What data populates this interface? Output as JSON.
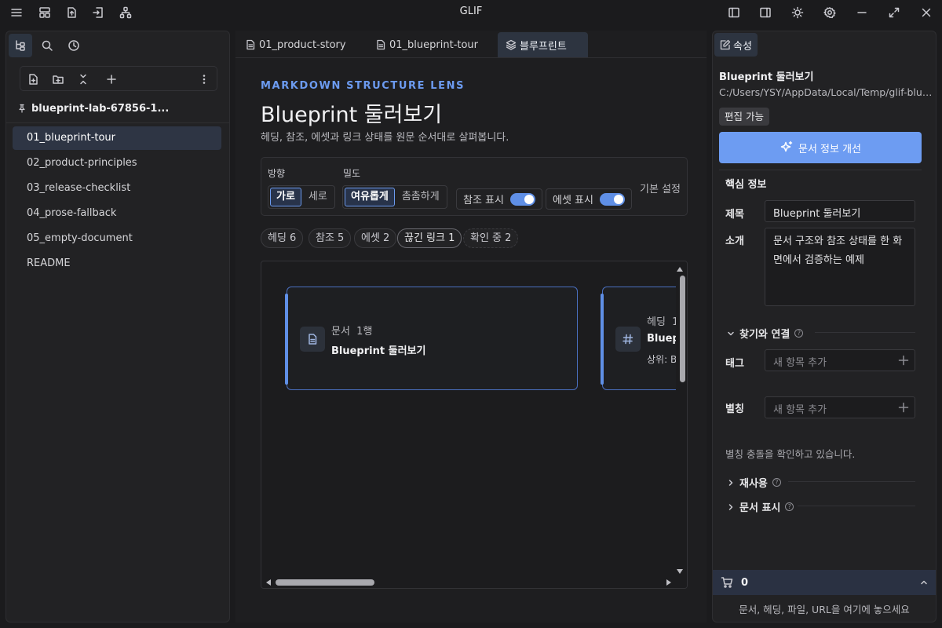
{
  "app": {
    "title": "GLIF"
  },
  "sidebar": {
    "vault_name": "blueprint-lab-67856-1...",
    "files": [
      {
        "label": "01_blueprint-tour",
        "active": true
      },
      {
        "label": "02_product-principles"
      },
      {
        "label": "03_release-checklist"
      },
      {
        "label": "04_prose-fallback"
      },
      {
        "label": "05_empty-document"
      },
      {
        "label": "README"
      }
    ]
  },
  "tabs": [
    {
      "label": "01_product-story"
    },
    {
      "label": "01_blueprint-tour"
    },
    {
      "label": "블루프린트",
      "active": true
    }
  ],
  "lens": {
    "eyebrow": "MARKDOWN STRUCTURE LENS",
    "title": "Blueprint 둘러보기",
    "subtitle": "헤딩, 참조, 에셋과 링크 상태를 원문 순서대로 살펴봅니다.",
    "orientation_label": "방향",
    "orientation_options": [
      "가로",
      "세로"
    ],
    "orientation_selected": "가로",
    "density_label": "밀도",
    "density_options": [
      "여유롭게",
      "촘촘하게"
    ],
    "density_selected": "여유롭게",
    "toggle_refs": "참조 표시",
    "toggle_assets": "에셋 표시",
    "reset_label": "기본 설정",
    "chips": [
      "헤딩 6",
      "참조 5",
      "에셋 2",
      "끊긴 링크 1",
      "확인 중 2"
    ],
    "nodes": [
      {
        "meta": "문서  1행",
        "title": "Blueprint 둘러보기"
      },
      {
        "meta": "헤딩  1",
        "title": "Bluep",
        "extra": "상위: B"
      }
    ]
  },
  "props": {
    "tab_label": "속성",
    "title": "Blueprint 둘러보기",
    "path": "C:/Users/YSY/AppData/Local/Temp/glif-blueprint-lab",
    "badge": "편집 가능",
    "improve_button": "문서 정보 개선",
    "core_section": "핵심 정보",
    "title_label": "제목",
    "title_value": "Blueprint 둘러보기",
    "intro_label": "소개",
    "intro_value": "문서 구조와 참조 상태를 한 화면에서 검증하는 예제",
    "find_section": "찾기와 연결",
    "tags_label": "태그",
    "tags_placeholder": "새 항목 추가",
    "alias_label": "별칭",
    "alias_placeholder": "새 항목 추가",
    "alias_note": "별칭 충돌을 확인하고 있습니다.",
    "reuse_section": "재사용",
    "display_section": "문서 표시",
    "cart_count": "0",
    "drop_hint": "문서, 헤딩, 파일, URL을 여기에 놓으세요"
  },
  "colors": {
    "accent": "#6d9cf2",
    "background": "#1b1b1d",
    "panel": "#222224"
  }
}
